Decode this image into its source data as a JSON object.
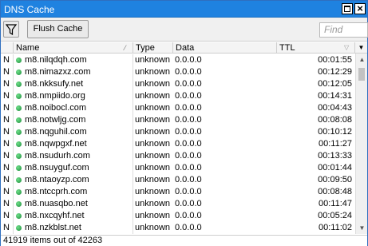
{
  "window": {
    "title": "DNS Cache"
  },
  "toolbar": {
    "flush_label": "Flush Cache",
    "find_placeholder": "Find"
  },
  "columns": {
    "flag": "",
    "name": "Name",
    "type": "Type",
    "data": "Data",
    "ttl": "TTL"
  },
  "rows": [
    {
      "flag": "N",
      "name": "m8.nilqdqh.com",
      "type": "unknown",
      "data": "0.0.0.0",
      "ttl": "00:01:55"
    },
    {
      "flag": "N",
      "name": "m8.nimazxz.com",
      "type": "unknown",
      "data": "0.0.0.0",
      "ttl": "00:12:29"
    },
    {
      "flag": "N",
      "name": "m8.nkksufy.net",
      "type": "unknown",
      "data": "0.0.0.0",
      "ttl": "00:12:05"
    },
    {
      "flag": "N",
      "name": "m8.nmpiido.org",
      "type": "unknown",
      "data": "0.0.0.0",
      "ttl": "00:14:31"
    },
    {
      "flag": "N",
      "name": "m8.noibocl.com",
      "type": "unknown",
      "data": "0.0.0.0",
      "ttl": "00:04:43"
    },
    {
      "flag": "N",
      "name": "m8.notwljg.com",
      "type": "unknown",
      "data": "0.0.0.0",
      "ttl": "00:08:08"
    },
    {
      "flag": "N",
      "name": "m8.nqguhil.com",
      "type": "unknown",
      "data": "0.0.0.0",
      "ttl": "00:10:12"
    },
    {
      "flag": "N",
      "name": "m8.nqwpgxf.net",
      "type": "unknown",
      "data": "0.0.0.0",
      "ttl": "00:11:27"
    },
    {
      "flag": "N",
      "name": "m8.nsudurh.com",
      "type": "unknown",
      "data": "0.0.0.0",
      "ttl": "00:13:33"
    },
    {
      "flag": "N",
      "name": "m8.nsuyguf.com",
      "type": "unknown",
      "data": "0.0.0.0",
      "ttl": "00:01:44"
    },
    {
      "flag": "N",
      "name": "m8.ntaoyzp.com",
      "type": "unknown",
      "data": "0.0.0.0",
      "ttl": "00:09:50"
    },
    {
      "flag": "N",
      "name": "m8.ntccprh.com",
      "type": "unknown",
      "data": "0.0.0.0",
      "ttl": "00:08:48"
    },
    {
      "flag": "N",
      "name": "m8.nuasqbo.net",
      "type": "unknown",
      "data": "0.0.0.0",
      "ttl": "00:11:47"
    },
    {
      "flag": "N",
      "name": "m8.nxcqyhf.net",
      "type": "unknown",
      "data": "0.0.0.0",
      "ttl": "00:05:24"
    },
    {
      "flag": "N",
      "name": "m8.nzkblst.net",
      "type": "unknown",
      "data": "0.0.0.0",
      "ttl": "00:11:02"
    }
  ],
  "status": {
    "text": "41919 items out of 42263"
  }
}
